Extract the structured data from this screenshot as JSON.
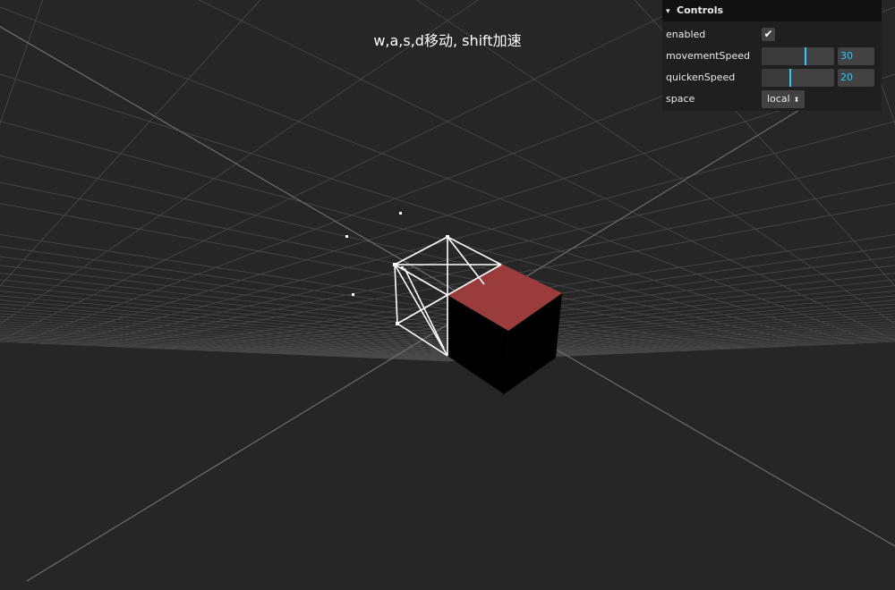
{
  "hint": "w,a,s,d移动, shift加速",
  "gui": {
    "title": "Controls",
    "chevron": "▾",
    "enabled": {
      "label": "enabled",
      "checked": true,
      "check_glyph": "✔"
    },
    "movementSpeed": {
      "label": "movementSpeed",
      "value": "30",
      "fraction": 0.6
    },
    "quickenSpeed": {
      "label": "quickenSpeed",
      "value": "20",
      "fraction": 0.4
    },
    "space": {
      "label": "space",
      "value": "local",
      "arrow": "⬍"
    }
  },
  "scene": {
    "background_color": "#262626",
    "grid_color": "#4a4a4a",
    "axis_color": "#6e6e6e",
    "cube_top_color": "#9b3c3c",
    "cube_side_color": "#000000",
    "helper_color": "#ffffff"
  }
}
